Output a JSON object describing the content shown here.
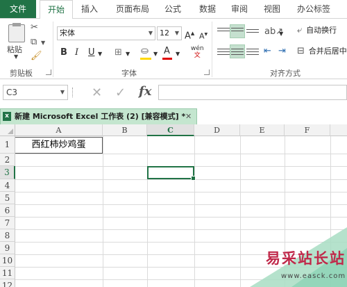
{
  "ribbon_tabs": {
    "file": "文件",
    "home": "开始",
    "insert": "插入",
    "page_layout": "页面布局",
    "formulas": "公式",
    "data": "数据",
    "review": "审阅",
    "view": "视图",
    "office_tab": "办公标签"
  },
  "clipboard": {
    "paste": "粘贴",
    "group_label": "剪贴板"
  },
  "font": {
    "name": "宋体",
    "size": "12",
    "bold": "B",
    "italic": "I",
    "underline": "U",
    "grow": "A",
    "shrink": "A",
    "font_color": "A",
    "phonetic": "wén",
    "group_label": "字体"
  },
  "alignment": {
    "wrap_text": "自动换行",
    "merge_center": "合并后居中",
    "group_label": "对齐方式"
  },
  "formula_bar": {
    "name_box": "C3",
    "fx": "fx",
    "formula": ""
  },
  "workbook_tab": {
    "title": "新建 Microsoft Excel 工作表 (2)  [兼容模式] *",
    "close": "✕"
  },
  "sheet": {
    "columns": [
      "A",
      "B",
      "C",
      "D",
      "E",
      "F"
    ],
    "rows": [
      "1",
      "2",
      "3",
      "4",
      "5",
      "6",
      "7",
      "8",
      "9",
      "10",
      "11",
      "12"
    ],
    "active_cell": "C3",
    "cell_a1": "西红柿炒鸡蛋"
  },
  "watermark": {
    "text": "易采站长站",
    "url": "www.easck.com"
  },
  "colors": {
    "accent": "#217346",
    "selected_tab": "#c4e6cf"
  }
}
